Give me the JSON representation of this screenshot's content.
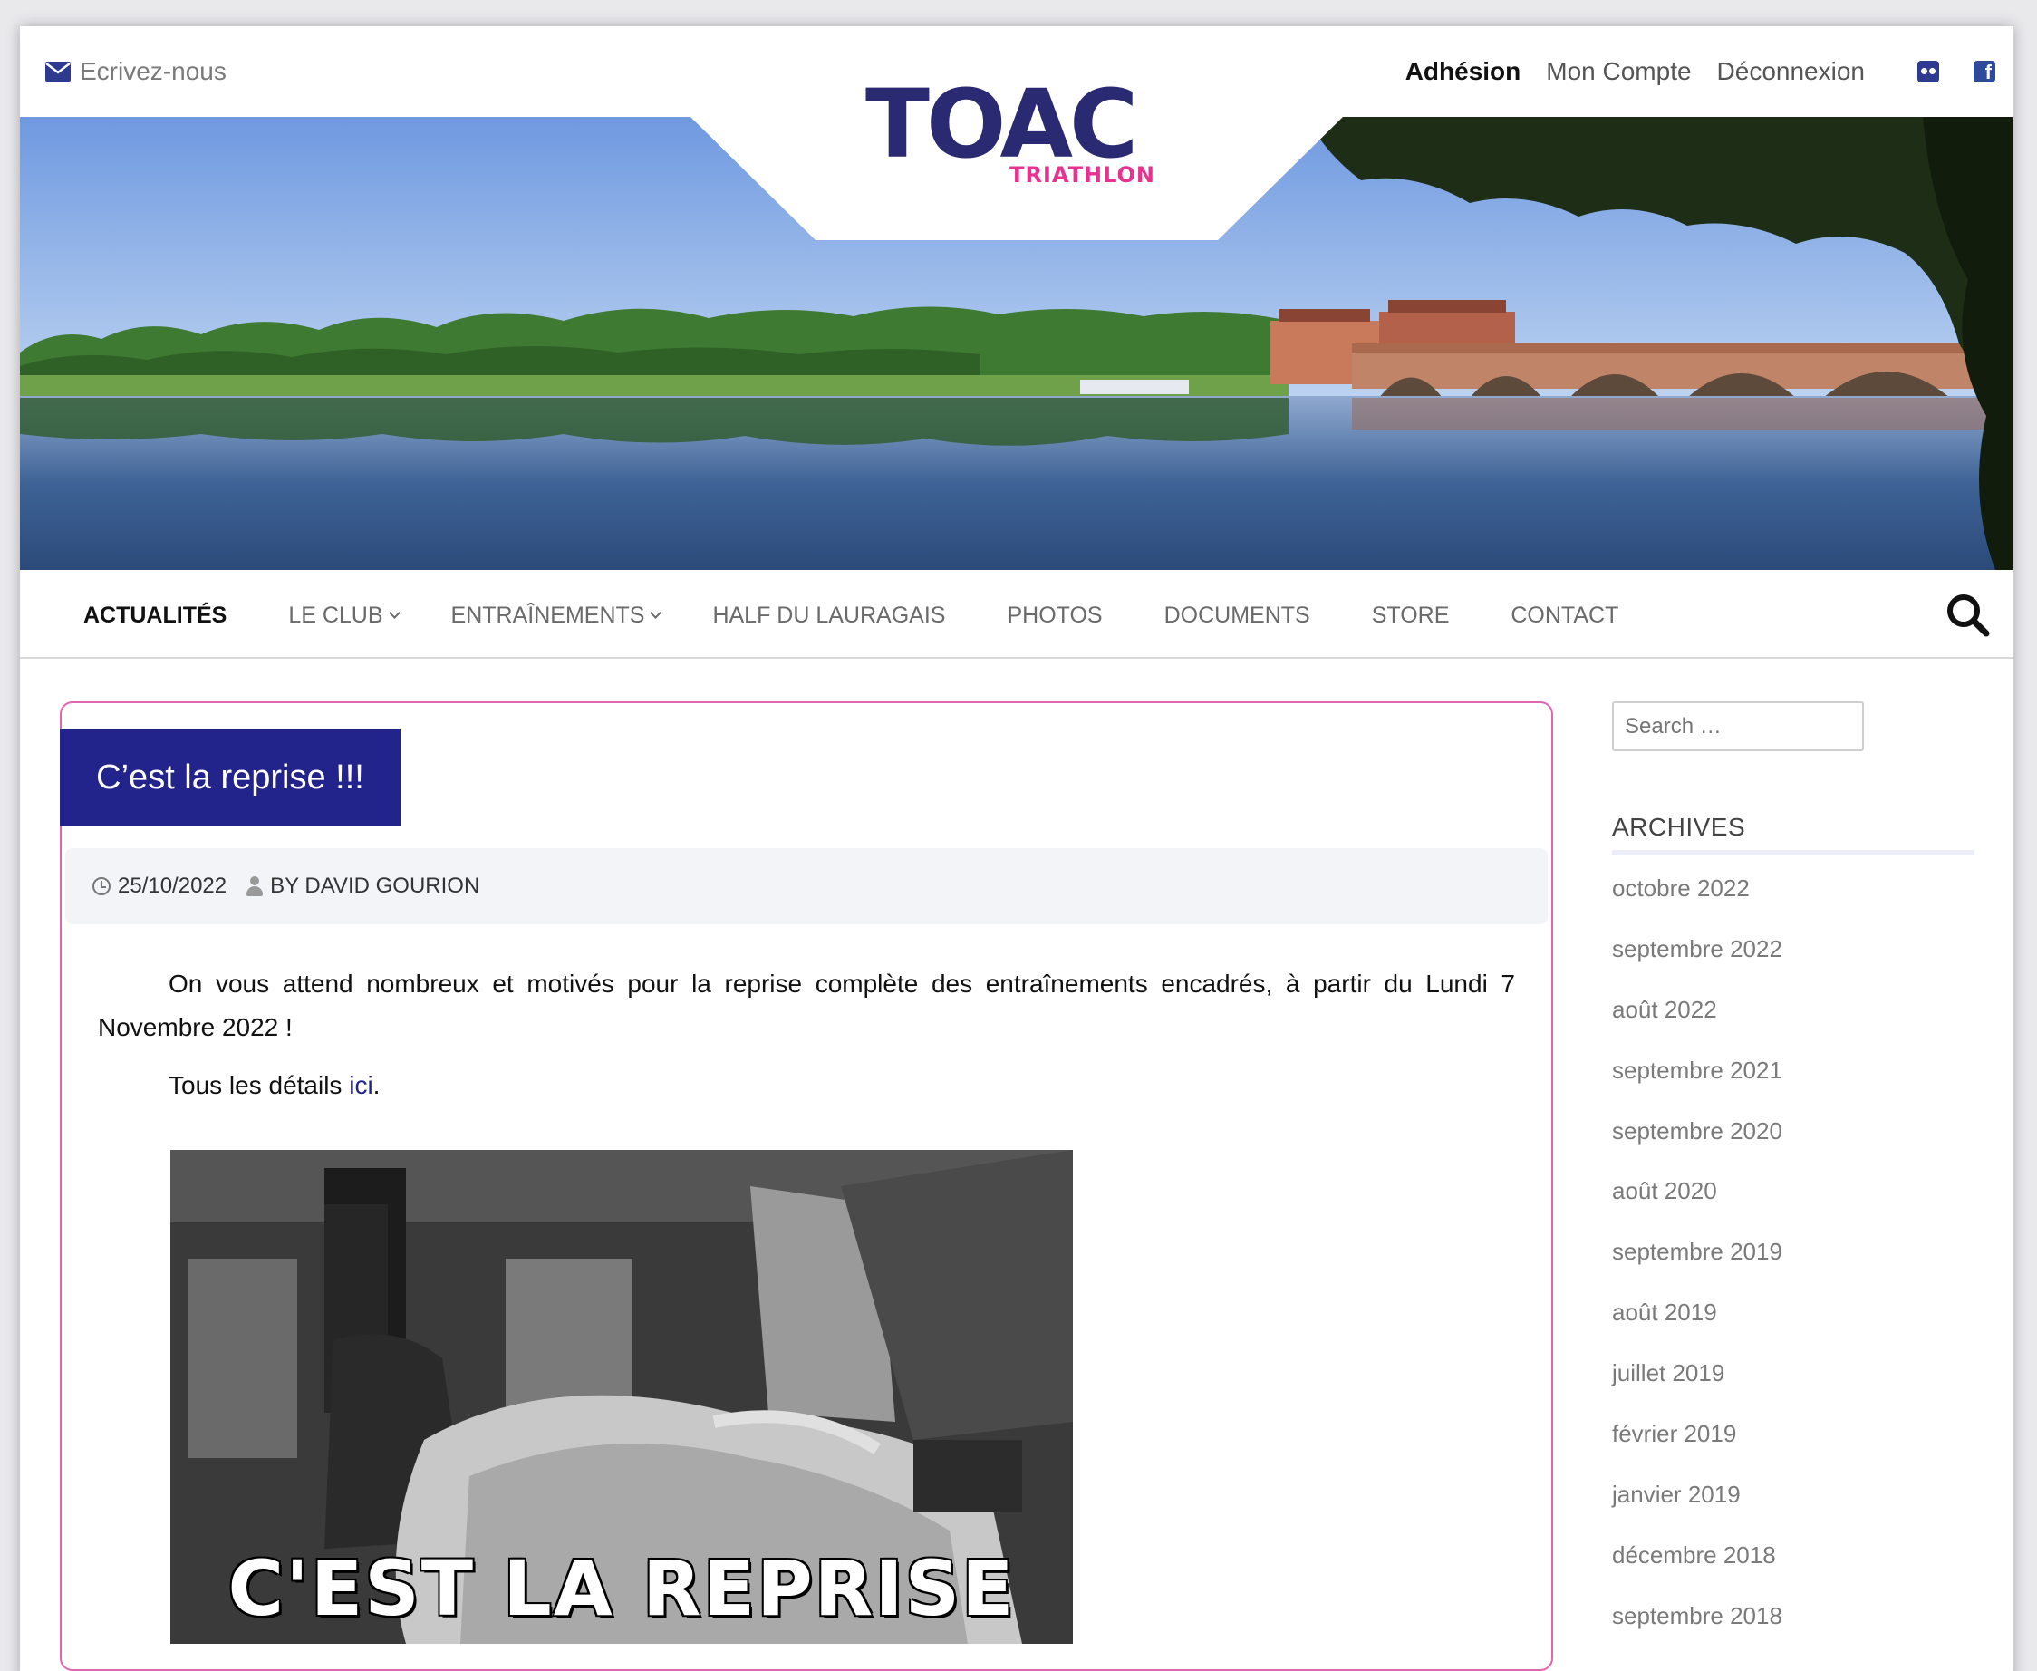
{
  "topbar": {
    "mail_label": "Ecrivez-nous",
    "links": [
      "Adhésion",
      "Mon Compte",
      "Déconnexion"
    ],
    "social_icons": [
      "flickr-icon",
      "facebook-icon"
    ]
  },
  "logo": {
    "main": "TOAC",
    "sub": "TRIATHLON"
  },
  "nav": {
    "items": [
      {
        "label": "ACTUALITÉS",
        "active": true,
        "dropdown": false
      },
      {
        "label": "LE CLUB",
        "active": false,
        "dropdown": true
      },
      {
        "label": "ENTRAÎNEMENTS",
        "active": false,
        "dropdown": true
      },
      {
        "label": "HALF DU LAURAGAIS",
        "active": false,
        "dropdown": false
      },
      {
        "label": "PHOTOS",
        "active": false,
        "dropdown": false
      },
      {
        "label": "DOCUMENTS",
        "active": false,
        "dropdown": false
      },
      {
        "label": "STORE",
        "active": false,
        "dropdown": false
      },
      {
        "label": "CONTACT",
        "active": false,
        "dropdown": false
      }
    ]
  },
  "article": {
    "title": "C’est la reprise !!!",
    "date": "25/10/2022",
    "author": "BY DAVID GOURION",
    "paragraph1": "On vous attend nombreux et motivés pour la reprise complète des entraînements encadrés, à partir du Lundi 7 Novembre 2022 !",
    "paragraph2_prefix": "Tous les détails ",
    "paragraph2_link": "ici",
    "paragraph2_suffix": ".",
    "image_caption": "C'EST LA REPRISE"
  },
  "sidebar": {
    "search_placeholder": "Search …",
    "archives_title": "ARCHIVES",
    "archives": [
      "octobre 2022",
      "septembre 2022",
      "août 2022",
      "septembre 2021",
      "septembre 2020",
      "août 2020",
      "septembre 2019",
      "août 2019",
      "juillet 2019",
      "février 2019",
      "janvier 2019",
      "décembre 2018",
      "septembre 2018"
    ]
  },
  "colors": {
    "accent": "#23238c",
    "card_border": "#e066b0",
    "logo_pink": "#e6338f"
  }
}
